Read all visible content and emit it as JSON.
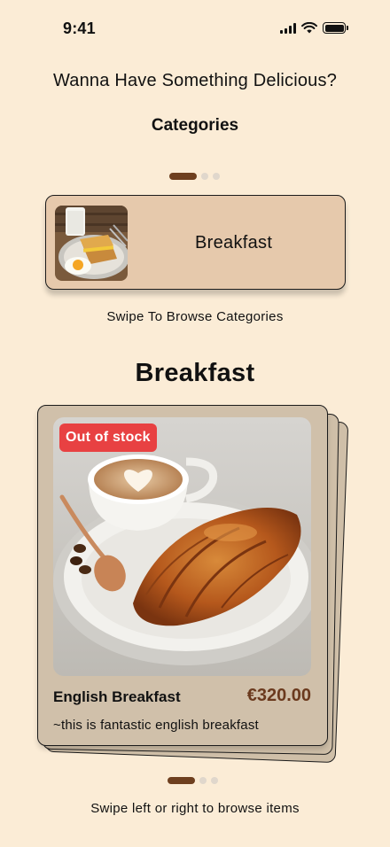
{
  "status_bar": {
    "time": "9:41",
    "icons": [
      "cellular-signal-icon",
      "wifi-icon",
      "battery-icon"
    ]
  },
  "header": {
    "headline": "Wanna Have Something Delicious?",
    "categories_title": "Categories"
  },
  "category_carousel": {
    "current_index": 0,
    "page_count": 3,
    "current_category": {
      "name": "Breakfast",
      "image": "breakfast-sandwich-photo"
    },
    "hint": "Swipe To Browse Categories"
  },
  "items_section": {
    "title": "Breakfast",
    "current_item": {
      "name": "English Breakfast",
      "price": "€320.00",
      "description": "~this is fantastic english breakfast",
      "badge": "Out of stock",
      "image": "croissant-and-coffee-photo"
    },
    "current_index": 0,
    "page_count": 3,
    "hint": "Swipe left or right to browse items"
  },
  "colors": {
    "background": "#fbecd6",
    "accent_brown": "#6e3f1f",
    "price_brown": "#6b3a1e",
    "category_card": "#e6c9ac",
    "item_card": "#d0c0aa",
    "badge_red": "#e84142"
  }
}
